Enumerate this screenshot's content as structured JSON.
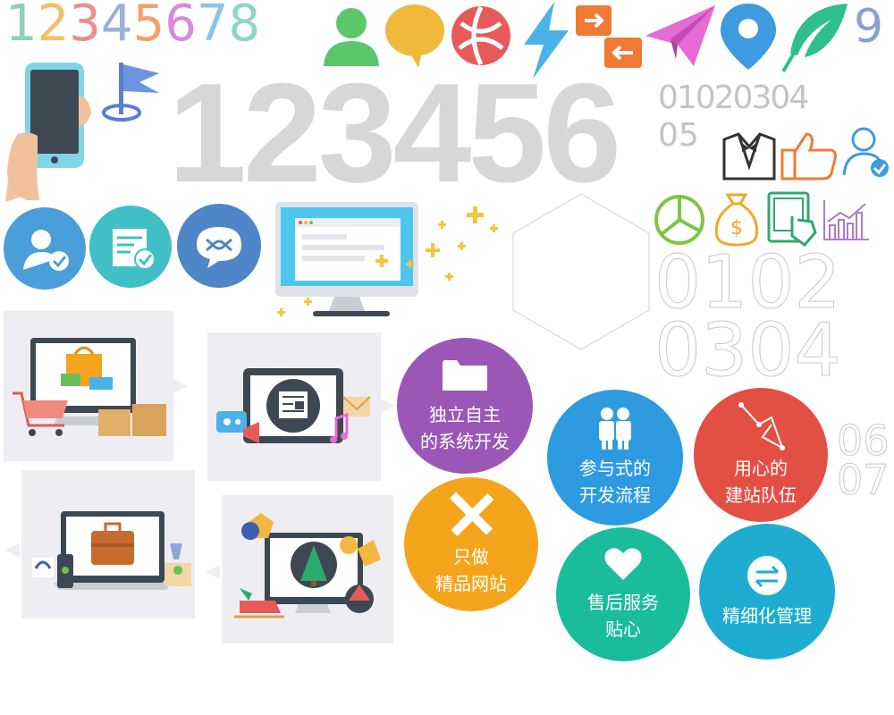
{
  "colored_digits": [
    {
      "text": "1",
      "color": "#8ed1b4"
    },
    {
      "text": "2",
      "color": "#f3c06a"
    },
    {
      "text": "3",
      "color": "#ec8d8d"
    },
    {
      "text": "4",
      "color": "#9ab0d6"
    },
    {
      "text": "5",
      "color": "#f2a16b"
    },
    {
      "text": "6",
      "color": "#d98ad8"
    },
    {
      "text": "7",
      "color": "#8dc2ea"
    },
    {
      "text": "8",
      "color": "#8ed6c6"
    }
  ],
  "small_nine": "9",
  "giant_digits": "123456",
  "gray_digits": {
    "line1": "01020304",
    "line2": "05"
  },
  "outline_digits": {
    "line1": "0102",
    "line2": "0304"
  },
  "side_digits": {
    "line1": "06",
    "line2": "07"
  },
  "features": [
    {
      "id": "independent-system",
      "text": "独立自主\n的系统开发",
      "color": "#9b57b6",
      "icon": "folder-icon"
    },
    {
      "id": "participatory-process",
      "text": "参与式的\n开发流程",
      "color": "#2e9be0",
      "icon": "people-icon"
    },
    {
      "id": "dedicated-team",
      "text": "用心的\n建站队伍",
      "color": "#e34f43",
      "icon": "pen-tool-icon"
    },
    {
      "id": "quality-sites",
      "text": "只做\n精品网站",
      "color": "#f5a51c",
      "icon": "pencil-ruler-icon"
    },
    {
      "id": "after-sales",
      "text": "售后服务\n贴心",
      "color": "#1bbc9b",
      "icon": "heart-icon"
    },
    {
      "id": "fine-management",
      "text": "精细化管理",
      "color": "#1eadd0",
      "icon": "sync-icon"
    }
  ],
  "icons": {
    "user": "user-icon",
    "chat": "chat-bubble-icon",
    "globe": "globe-icon",
    "bolt": "lightning-icon",
    "transfer": "transfer-arrows-icon",
    "plane": "paper-plane-icon",
    "pin": "location-pin-icon",
    "feather": "feather-icon",
    "phone": "hand-phone-icon",
    "flag": "flag-icon",
    "suit": "tuxedo-icon",
    "thumb": "thumbs-up-icon",
    "user_check": "user-check-icon",
    "pie": "pie-chart-icon",
    "moneybag": "money-bag-icon",
    "tablet_touch": "tablet-touch-icon",
    "bar_chart": "bar-chart-icon",
    "badge_user": "user-check-badge-icon",
    "badge_doc": "document-check-badge-icon",
    "badge_chat": "chat-link-badge-icon",
    "monitor": "desktop-monitor-icon",
    "hexagon": "hexagon-outline-icon"
  },
  "colors": {
    "gray": "#d7d7d7",
    "badge_blue": "#4a9fdb",
    "badge_teal": "#40c0c6",
    "badge_navy": "#4f86c7"
  }
}
